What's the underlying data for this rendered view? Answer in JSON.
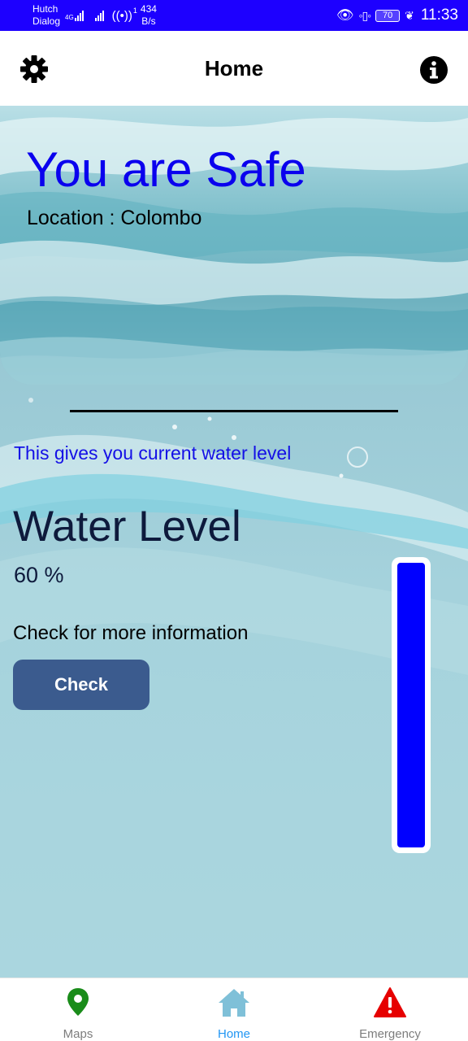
{
  "status_bar": {
    "carrier1": "Hutch",
    "carrier2": "Dialog",
    "network_tag": "4G",
    "hotspot_count": "1",
    "speed_value": "434",
    "speed_unit": "B/s",
    "battery": "70",
    "time": "11:33"
  },
  "app_bar": {
    "title": "Home",
    "left_icon": "gear-icon",
    "right_icon": "info-icon"
  },
  "hero": {
    "status": "You are Safe",
    "location": "Location : Colombo"
  },
  "content": {
    "subtitle": "This gives you current water level",
    "level_heading": "Water Level",
    "level_value": "60 %",
    "check_prompt": "Check for more information",
    "check_button": "Check"
  },
  "gauge": {
    "fill_fraction": 1.0,
    "fill_color": "#0000ff"
  },
  "bottom_nav": {
    "items": [
      {
        "label": "Maps",
        "icon": "map-pin-icon",
        "color": "#1a8c1a",
        "active": false
      },
      {
        "label": "Home",
        "icon": "home-icon",
        "color": "#7fc0d8",
        "active": true
      },
      {
        "label": "Emergency",
        "icon": "warning-icon",
        "color": "#e60000",
        "active": false
      }
    ]
  },
  "colors": {
    "status_bar": "#1d00ff",
    "safe_text": "#0a00ee",
    "subtitle_text": "#1410e6",
    "button": "#3b5b8e",
    "active_tab": "#2196f3"
  }
}
